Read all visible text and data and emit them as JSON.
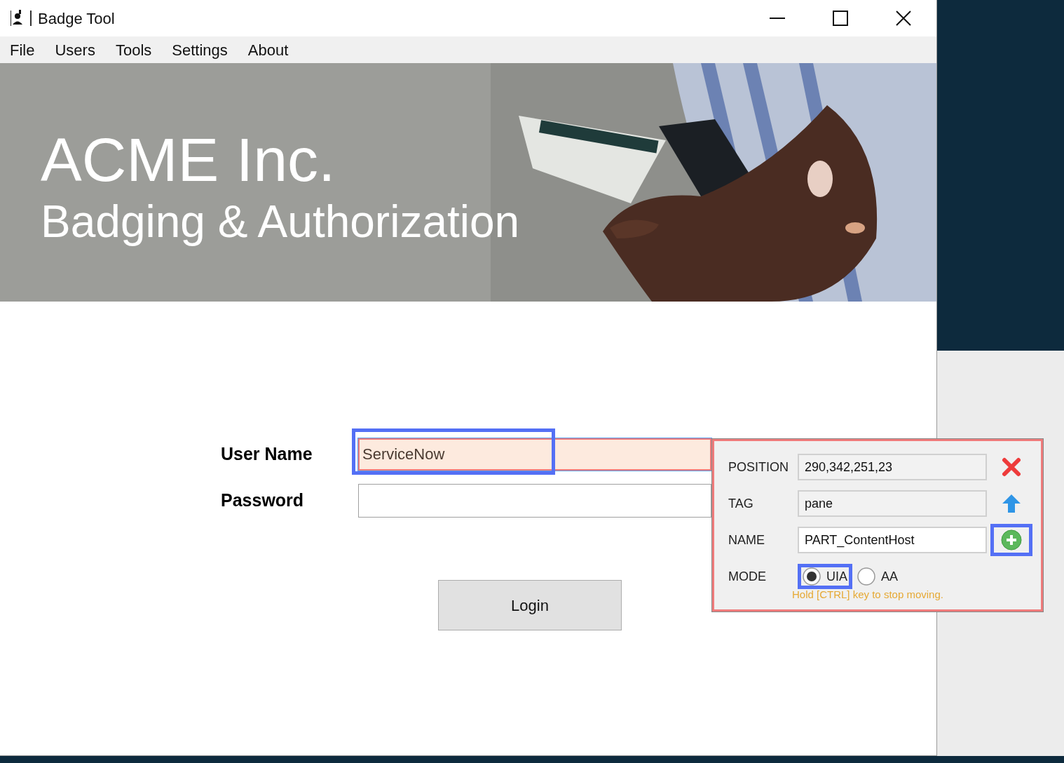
{
  "window": {
    "title": "Badge Tool"
  },
  "menu": [
    "File",
    "Users",
    "Tools",
    "Settings",
    "About"
  ],
  "banner": {
    "kind": "picture",
    "heading": "ACME Inc.",
    "subheading": "Badging & Authorization"
  },
  "form": {
    "fields": [
      {
        "label": "User Name",
        "value": "ServiceNow",
        "highlighted": true
      },
      {
        "label": "Password",
        "highlighted": false
      }
    ],
    "login_button": "Login"
  },
  "inspector": {
    "rows": [
      {
        "label": "POSITION",
        "value": "290,342,251,23",
        "kind": "delete",
        "highlighted": false
      },
      {
        "label": "TAG",
        "value": "pane",
        "kind": "up",
        "highlighted": false
      },
      {
        "label": "NAME",
        "value": "PART_ContentHost",
        "kind": "add",
        "highlighted": true
      }
    ],
    "mode": {
      "label": "MODE",
      "options": [
        {
          "label": "UIA",
          "selected": true,
          "highlighted": true
        },
        {
          "label": "AA",
          "selected": false,
          "highlighted": false
        }
      ]
    },
    "hint": "Hold [CTRL] key to stop moving."
  }
}
